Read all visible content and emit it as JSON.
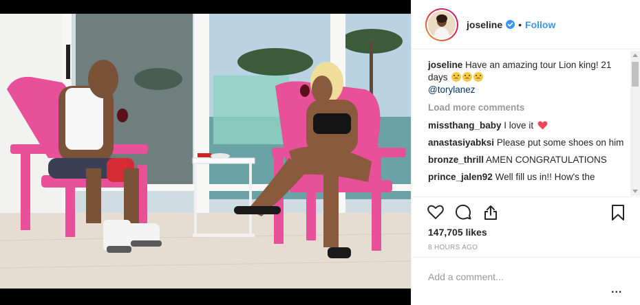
{
  "post": {
    "username": "joseline",
    "follow_label": "Follow",
    "separator": "•",
    "caption_user": "joseline",
    "caption_text": "Have an amazing tour Lion king! 21 days",
    "caption_mention": "@torylanez",
    "load_more": "Load more comments",
    "comments": [
      {
        "user": "missthang_baby",
        "text": "I love it"
      },
      {
        "user": "anastasiyabksi",
        "text": "Please put some shoes on him"
      },
      {
        "user": "bronze_thrill",
        "text": "AMEN CONGRATULATIONS"
      },
      {
        "user": "prince_jalen92",
        "text": "Well fill us in!! How's the"
      }
    ],
    "likes": "147,705 likes",
    "time_ago": "8 HOURS AGO",
    "add_comment_placeholder": "Add a comment...",
    "more_options": "..."
  },
  "colors": {
    "follow_blue": "#3897f0",
    "mention_blue": "#003569",
    "heart_red": "#ed4956",
    "chair_pink": "#e8509a"
  },
  "icons": [
    "verified-badge-icon",
    "heart-outline-icon",
    "comment-icon",
    "share-icon",
    "bookmark-icon",
    "red-heart-emoji",
    "face-emoji"
  ]
}
